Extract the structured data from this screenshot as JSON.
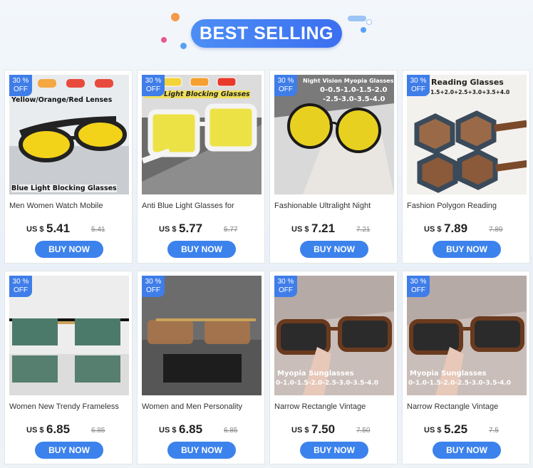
{
  "header": {
    "title": "BEST SELLING"
  },
  "button_label": "BUY NOW",
  "badge": {
    "pct": "30 %",
    "off": "OFF"
  },
  "products": [
    {
      "title": "Men Women Watch Mobile",
      "currency": "US $",
      "price": "5.41",
      "original": "5.41",
      "overlay_top": "Yellow/Orange/Red Lenses",
      "overlay_bottom": "Blue Light Blocking Glasses",
      "accent": "#f3d21a"
    },
    {
      "title": "Anti Blue Light Glasses for",
      "currency": "US $",
      "price": "5.77",
      "original": "5.77",
      "overlay_top": "Blue Light Blocking Glasses",
      "overlay_bottom": "",
      "accent": "#f0e04a"
    },
    {
      "title": "Fashionable Ultralight Night",
      "currency": "US $",
      "price": "7.21",
      "original": "7.21",
      "overlay_top": "Night Vision Myopia Glasses",
      "overlay_mid1": "0-0.5-1.0-1.5-2.0",
      "overlay_mid2": "-2.5-3.0-3.5-4.0",
      "accent": "#e8d020"
    },
    {
      "title": "Fashion Polygon Reading",
      "currency": "US $",
      "price": "7.89",
      "original": "7.89",
      "overlay_top": "Reading Glasses",
      "overlay_mid1": "0+1.0+1.5+2.0+2.5+3.0+3.5+4.0",
      "accent": "#8b5a34"
    },
    {
      "title": "Women New Trendy Frameless",
      "currency": "US $",
      "price": "6.85",
      "original": "6.85",
      "accent": "#2d5a48"
    },
    {
      "title": "Women and Men Personality",
      "currency": "US $",
      "price": "6.85",
      "original": "6.85",
      "accent": "#8a6040"
    },
    {
      "title": "Narrow Rectangle Vintage",
      "currency": "US $",
      "price": "7.50",
      "original": "7.50",
      "overlay_bottom1": "Myopia Sunglasses",
      "overlay_bottom2": "0-1.0-1.5-2.0-2.5-3.0-3.5-4.0",
      "accent": "#3a2a22"
    },
    {
      "title": "Narrow Rectangle Vintage",
      "currency": "US $",
      "price": "5.25",
      "original": "7.5",
      "overlay_bottom1": "Myopia Sunglasses",
      "overlay_bottom2": "0-1.0-1.5-2.0-2.5-3.0-3.5-4.0",
      "accent": "#3a2a22"
    }
  ]
}
